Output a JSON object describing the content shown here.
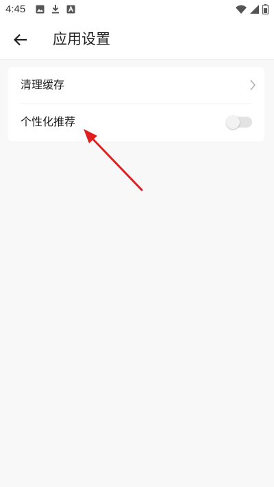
{
  "status_bar": {
    "time": "4:45",
    "left_icons": [
      "image-icon",
      "download-icon",
      "app-a-icon"
    ],
    "right_icons": [
      "wifi-icon",
      "signal-icon",
      "battery-icon"
    ]
  },
  "app_bar": {
    "title": "应用设置",
    "back_icon": "arrow-left-icon"
  },
  "settings": {
    "items": [
      {
        "label": "清理缓存",
        "control": "chevron-right-icon"
      },
      {
        "label": "个性化推荐",
        "control": "toggle",
        "enabled": false
      }
    ]
  },
  "colors": {
    "annotation_arrow": "#e02020",
    "toggle_track_off": "#e3e3e3",
    "background": "#f8f8f8"
  }
}
